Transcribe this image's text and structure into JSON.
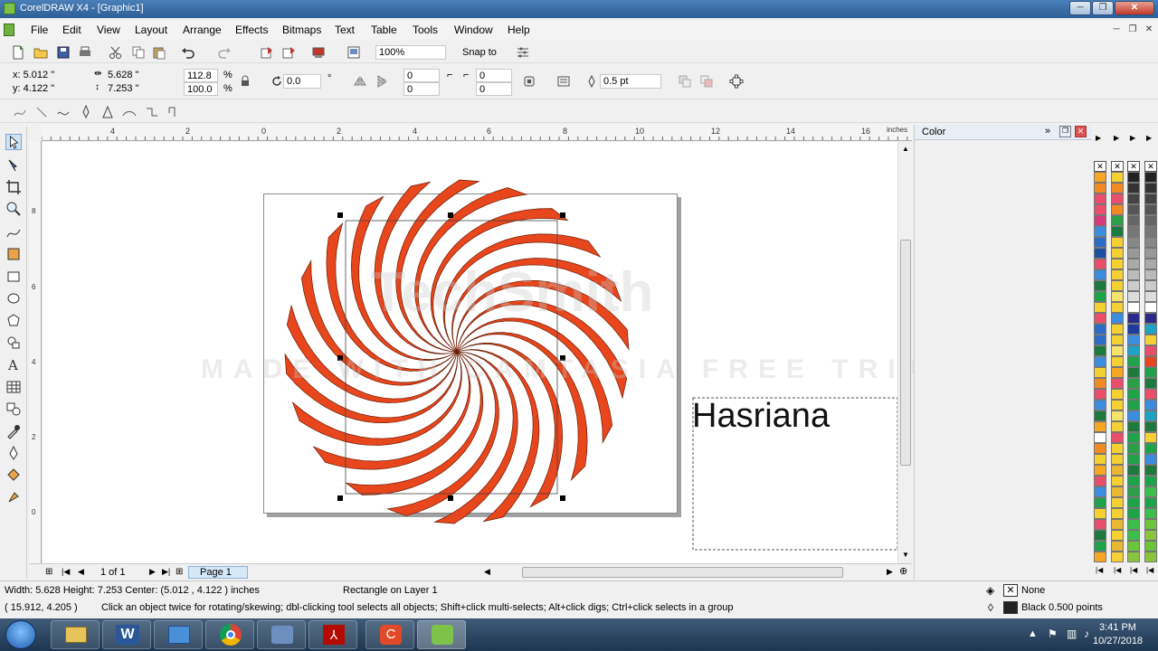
{
  "window": {
    "title": "CorelDRAW X4 - [Graphic1]"
  },
  "menu": [
    "File",
    "Edit",
    "View",
    "Layout",
    "Arrange",
    "Effects",
    "Bitmaps",
    "Text",
    "Table",
    "Tools",
    "Window",
    "Help"
  ],
  "standard_toolbar": {
    "zoom": "100%",
    "snap_to": "Snap to"
  },
  "property_bar": {
    "x": "x: 5.012 \"",
    "y": "y: 4.122 \"",
    "width": "5.628 \"",
    "height": "7.253 \"",
    "scale_x": "112.8",
    "scale_y": "100.0",
    "percent": "%",
    "rotation": "0.0",
    "degree": "°",
    "corner1": "0",
    "corner2": "0",
    "corner3": "0",
    "corner4": "0",
    "outline_width": "0.5 pt"
  },
  "ruler": {
    "unit": "inches",
    "h_ticks": [
      "4",
      "2",
      "0",
      "2",
      "4",
      "6",
      "8",
      "10",
      "12",
      "14",
      "16"
    ],
    "v_ticks": [
      "8",
      "6",
      "4",
      "2",
      "0"
    ]
  },
  "canvas": {
    "text_object": "Hasriana",
    "spiral_color": "#e8461c"
  },
  "watermark": {
    "line1": "TechSmith",
    "line2": "MADE WITH CAMTASIA FREE TRIAL"
  },
  "page_nav": {
    "position": "1 of 1",
    "page_tab": "Page 1"
  },
  "docker": {
    "title": "Color"
  },
  "status": {
    "dimensions": "Width: 5.628  Height: 7.253  Center: (5.012 , 4.122 )  inches",
    "selection": "Rectangle on Layer 1",
    "cursor": "( 15.912, 4.205 )",
    "hint": "Click an object twice for rotating/skewing; dbl-clicking tool selects all objects; Shift+click multi-selects; Alt+click digs; Ctrl+click selects in a group",
    "fill": "None",
    "outline": "Black  0.500 points"
  },
  "taskbar": {
    "time": "3:41 PM",
    "date": "10/27/2018"
  },
  "palette_colors": {
    "col1": [
      "#f5a623",
      "#f08a24",
      "#e94e6a",
      "#e94e6a",
      "#d63a7a",
      "#3c8dde",
      "#2b6cc4",
      "#1e4fa3",
      "#e94e6a",
      "#3c8dde",
      "#1e7a3c",
      "#1fa34a",
      "#f5d033",
      "#e94e6a",
      "#2b6cc4",
      "#2b6cc4",
      "#1e7a3c",
      "#3c8dde",
      "#f5d033",
      "#f08a24",
      "#e94e6a",
      "#3c8dde",
      "#1e7a3c",
      "#f5a623",
      "#ffffff",
      "#f08a24",
      "#f5d033",
      "#f5a623",
      "#e94e6a",
      "#3c8dde",
      "#1fa34a",
      "#f5d033",
      "#e94e6a",
      "#1e7a3c",
      "#1fa34a",
      "#f5a623"
    ],
    "col2": [
      "#f5d033",
      "#f08a24",
      "#e94e6a",
      "#f08a24",
      "#2b9e4a",
      "#1e7a3c",
      "#f5d033",
      "#f5d033",
      "#f5d033",
      "#f5d033",
      "#f5d033",
      "#f5e36a",
      "#f5d033",
      "#3c8dde",
      "#f5d033",
      "#f5d033",
      "#f5e36a",
      "#f5d033",
      "#f5a623",
      "#e94e6a",
      "#f5d033",
      "#f5d033",
      "#f5e36a",
      "#f5d033",
      "#e94e6a",
      "#f5d033",
      "#f5d033",
      "#e9b833",
      "#f5d033",
      "#e9b833",
      "#f5d033",
      "#f5d033",
      "#e9b833",
      "#f5d033",
      "#e9b833",
      "#f5d033"
    ],
    "col3": [
      "#222222",
      "#333333",
      "#444444",
      "#555555",
      "#666666",
      "#777777",
      "#888888",
      "#999999",
      "#aaaaaa",
      "#bbbbbb",
      "#cccccc",
      "#dddddd",
      "#ffffff",
      "#2a2a8a",
      "#1e3c9e",
      "#3c8dde",
      "#1fa3c4",
      "#1fa34a",
      "#1e7a3c",
      "#2b9e4a",
      "#1fa34a",
      "#1fa34a",
      "#3c8dde",
      "#1e7a3c",
      "#1fa34a",
      "#2b9e4a",
      "#1fa34a",
      "#1e7a3c",
      "#1fa34a",
      "#2b9e4a",
      "#1fa34a",
      "#1fa34a",
      "#3cbf4a",
      "#3cbf4a",
      "#6ac43c",
      "#8ac43c"
    ],
    "col4": [
      "#222222",
      "#333333",
      "#444444",
      "#555555",
      "#666666",
      "#777777",
      "#888888",
      "#999999",
      "#aaaaaa",
      "#bbbbbb",
      "#cccccc",
      "#dddddd",
      "#ffffff",
      "#2a2a8a",
      "#1fa3c4",
      "#f5d033",
      "#e94e6a",
      "#e8461c",
      "#1fa34a",
      "#1e7a3c",
      "#e94e6a",
      "#3c8dde",
      "#1fa3c4",
      "#1e7a3c",
      "#f5d033",
      "#1fa34a",
      "#3c8dde",
      "#1e7a3c",
      "#1fa34a",
      "#3cbf4a",
      "#1fa34a",
      "#3cbf4a",
      "#6ac43c",
      "#8ac43c",
      "#6ac43c",
      "#8ac43c"
    ]
  }
}
